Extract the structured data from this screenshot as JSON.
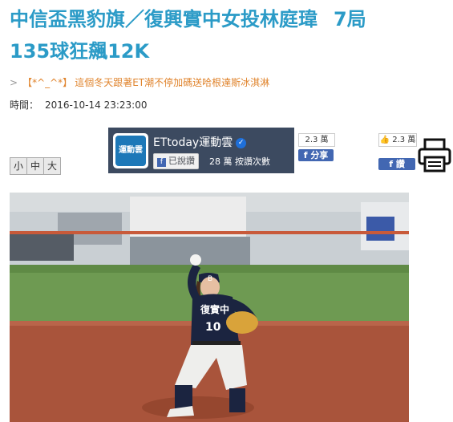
{
  "article": {
    "title_line1_a": "中信盃黑豹旗／復興實中女投林庭瑋",
    "title_line1_b": "7局",
    "title_line2": "135球狂飆12K"
  },
  "related": {
    "tag": "【*^_^*】",
    "text": "這個冬天跟著ET潮不停加碼送哈根達斯冰淇淋"
  },
  "meta": {
    "time_label": "時間：",
    "time_value": "2016-10-14 23:23:00"
  },
  "font_size": {
    "small": "小",
    "medium": "中",
    "large": "大"
  },
  "fan_page": {
    "logo_text": "運動雲",
    "name": "ETtoday運動雲",
    "liked_label": "已說讚",
    "like_count": "28 萬 按讚次數"
  },
  "share": {
    "count": "2.3 萬",
    "label": "分享"
  },
  "like": {
    "count": "2.3 萬",
    "label": "讚"
  },
  "icons": {
    "print": "printer-icon",
    "verified": "check-badge-icon",
    "thumb": "thumbs-up-icon",
    "facebook": "facebook-icon"
  },
  "colors": {
    "title": "#2b9bc7",
    "related": "#e0842d",
    "facebook": "#4267b2",
    "fan_page_bg": "#3c4a60"
  }
}
